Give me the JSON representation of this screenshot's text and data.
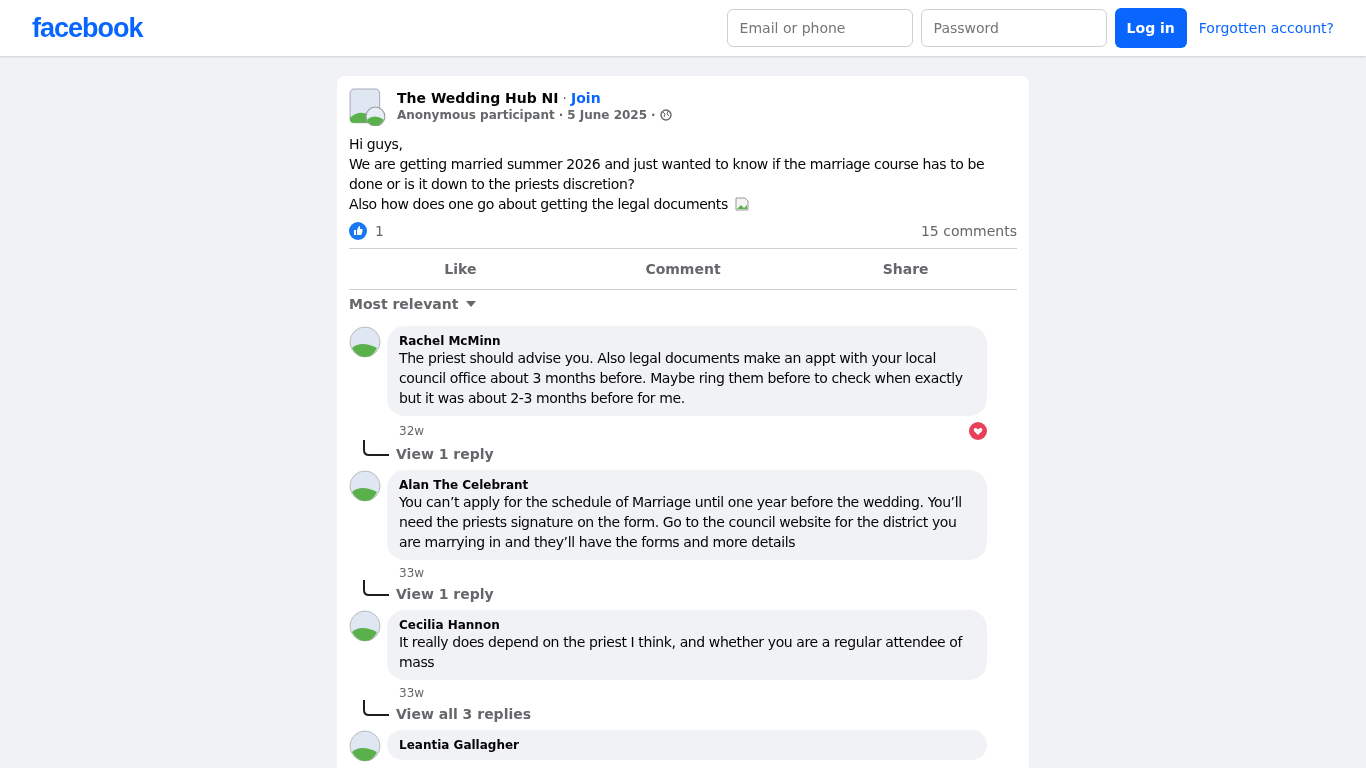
{
  "header": {
    "logo": "facebook",
    "email": {
      "placeholder": "Email or phone"
    },
    "password": {
      "placeholder": "Password"
    },
    "login": "Log in",
    "forgotten": "Forgotten account?"
  },
  "post": {
    "group": "The Wedding Hub NI",
    "join": "Join",
    "separator": "·",
    "author": "Anonymous participant",
    "date": "5 June 2025",
    "lines": [
      "Hi guys,",
      "We are getting married summer 2026 and just wanted to know if the marriage course has to be done or is it down to the priests discretion?",
      "Also how does one go about getting the legal documents"
    ],
    "likes": "1",
    "comments_count": "15 comments",
    "actions": [
      "Like",
      "Comment",
      "Share"
    ],
    "sort": "Most relevant",
    "comments": [
      {
        "name": "Rachel McMinn",
        "text": "The priest should advise you. Also legal documents make an appt with your local council office about 3 months before. Maybe ring them before to check when exactly but it was about 2-3 months before for me.",
        "time": "32w",
        "heart": true,
        "replies": "View 1 reply"
      },
      {
        "name": "Alan The Celebrant",
        "text": "You can’t apply for the schedule of Marriage until one year before the wedding. You’ll need the priests signature on the form. Go to the council website for the district you are marrying in and they’ll have the forms and more details",
        "time": "33w",
        "replies": "View 1 reply"
      },
      {
        "name": "Cecilia Hannon",
        "text": "It really does depend on the priest I think, and whether you are a regular attendee of mass",
        "time": "33w",
        "replies": "View all 3 replies"
      },
      {
        "name": "Leantia Gallagher"
      }
    ]
  }
}
